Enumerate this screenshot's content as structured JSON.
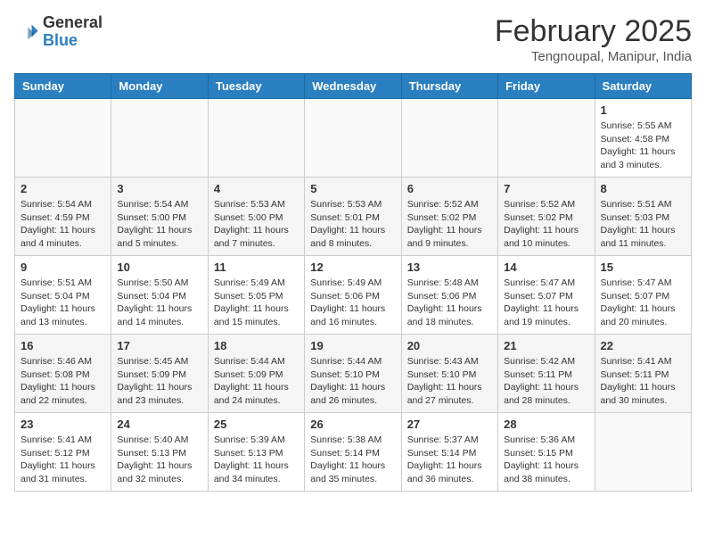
{
  "header": {
    "logo_general": "General",
    "logo_blue": "Blue",
    "month": "February 2025",
    "location": "Tengnoupal, Manipur, India"
  },
  "days_of_week": [
    "Sunday",
    "Monday",
    "Tuesday",
    "Wednesday",
    "Thursday",
    "Friday",
    "Saturday"
  ],
  "weeks": [
    [
      {
        "day": "",
        "info": ""
      },
      {
        "day": "",
        "info": ""
      },
      {
        "day": "",
        "info": ""
      },
      {
        "day": "",
        "info": ""
      },
      {
        "day": "",
        "info": ""
      },
      {
        "day": "",
        "info": ""
      },
      {
        "day": "1",
        "info": "Sunrise: 5:55 AM\nSunset: 4:58 PM\nDaylight: 11 hours\nand 3 minutes."
      }
    ],
    [
      {
        "day": "2",
        "info": "Sunrise: 5:54 AM\nSunset: 4:59 PM\nDaylight: 11 hours\nand 4 minutes."
      },
      {
        "day": "3",
        "info": "Sunrise: 5:54 AM\nSunset: 5:00 PM\nDaylight: 11 hours\nand 5 minutes."
      },
      {
        "day": "4",
        "info": "Sunrise: 5:53 AM\nSunset: 5:00 PM\nDaylight: 11 hours\nand 7 minutes."
      },
      {
        "day": "5",
        "info": "Sunrise: 5:53 AM\nSunset: 5:01 PM\nDaylight: 11 hours\nand 8 minutes."
      },
      {
        "day": "6",
        "info": "Sunrise: 5:52 AM\nSunset: 5:02 PM\nDaylight: 11 hours\nand 9 minutes."
      },
      {
        "day": "7",
        "info": "Sunrise: 5:52 AM\nSunset: 5:02 PM\nDaylight: 11 hours\nand 10 minutes."
      },
      {
        "day": "8",
        "info": "Sunrise: 5:51 AM\nSunset: 5:03 PM\nDaylight: 11 hours\nand 11 minutes."
      }
    ],
    [
      {
        "day": "9",
        "info": "Sunrise: 5:51 AM\nSunset: 5:04 PM\nDaylight: 11 hours\nand 13 minutes."
      },
      {
        "day": "10",
        "info": "Sunrise: 5:50 AM\nSunset: 5:04 PM\nDaylight: 11 hours\nand 14 minutes."
      },
      {
        "day": "11",
        "info": "Sunrise: 5:49 AM\nSunset: 5:05 PM\nDaylight: 11 hours\nand 15 minutes."
      },
      {
        "day": "12",
        "info": "Sunrise: 5:49 AM\nSunset: 5:06 PM\nDaylight: 11 hours\nand 16 minutes."
      },
      {
        "day": "13",
        "info": "Sunrise: 5:48 AM\nSunset: 5:06 PM\nDaylight: 11 hours\nand 18 minutes."
      },
      {
        "day": "14",
        "info": "Sunrise: 5:47 AM\nSunset: 5:07 PM\nDaylight: 11 hours\nand 19 minutes."
      },
      {
        "day": "15",
        "info": "Sunrise: 5:47 AM\nSunset: 5:07 PM\nDaylight: 11 hours\nand 20 minutes."
      }
    ],
    [
      {
        "day": "16",
        "info": "Sunrise: 5:46 AM\nSunset: 5:08 PM\nDaylight: 11 hours\nand 22 minutes."
      },
      {
        "day": "17",
        "info": "Sunrise: 5:45 AM\nSunset: 5:09 PM\nDaylight: 11 hours\nand 23 minutes."
      },
      {
        "day": "18",
        "info": "Sunrise: 5:44 AM\nSunset: 5:09 PM\nDaylight: 11 hours\nand 24 minutes."
      },
      {
        "day": "19",
        "info": "Sunrise: 5:44 AM\nSunset: 5:10 PM\nDaylight: 11 hours\nand 26 minutes."
      },
      {
        "day": "20",
        "info": "Sunrise: 5:43 AM\nSunset: 5:10 PM\nDaylight: 11 hours\nand 27 minutes."
      },
      {
        "day": "21",
        "info": "Sunrise: 5:42 AM\nSunset: 5:11 PM\nDaylight: 11 hours\nand 28 minutes."
      },
      {
        "day": "22",
        "info": "Sunrise: 5:41 AM\nSunset: 5:11 PM\nDaylight: 11 hours\nand 30 minutes."
      }
    ],
    [
      {
        "day": "23",
        "info": "Sunrise: 5:41 AM\nSunset: 5:12 PM\nDaylight: 11 hours\nand 31 minutes."
      },
      {
        "day": "24",
        "info": "Sunrise: 5:40 AM\nSunset: 5:13 PM\nDaylight: 11 hours\nand 32 minutes."
      },
      {
        "day": "25",
        "info": "Sunrise: 5:39 AM\nSunset: 5:13 PM\nDaylight: 11 hours\nand 34 minutes."
      },
      {
        "day": "26",
        "info": "Sunrise: 5:38 AM\nSunset: 5:14 PM\nDaylight: 11 hours\nand 35 minutes."
      },
      {
        "day": "27",
        "info": "Sunrise: 5:37 AM\nSunset: 5:14 PM\nDaylight: 11 hours\nand 36 minutes."
      },
      {
        "day": "28",
        "info": "Sunrise: 5:36 AM\nSunset: 5:15 PM\nDaylight: 11 hours\nand 38 minutes."
      },
      {
        "day": "",
        "info": ""
      }
    ]
  ]
}
